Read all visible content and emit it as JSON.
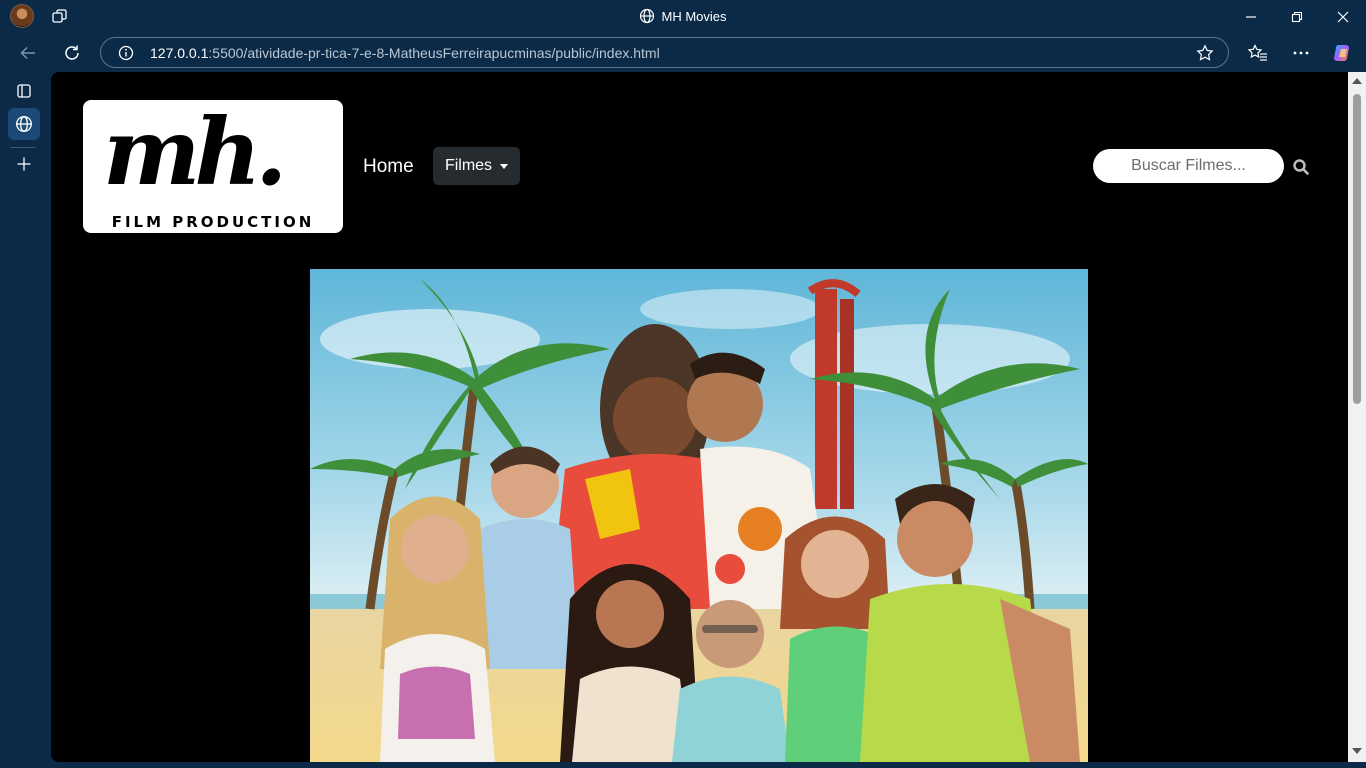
{
  "browser": {
    "window_title": "MH Movies",
    "url_host": "127.0.0.1",
    "url_path": ":5500/atividade-pr-tica-7-e-8-MatheusFerreirapucminas/public/index.html"
  },
  "site": {
    "logo_mark": "mh.",
    "logo_subtitle": "FILM PRODUCTION",
    "nav": {
      "home_label": "Home",
      "films_label": "Filmes"
    },
    "search": {
      "placeholder": "Buscar Filmes..."
    }
  },
  "colors": {
    "browser_bg": "#0b2a47",
    "page_bg": "#000000",
    "films_button_bg": "#262b30"
  }
}
